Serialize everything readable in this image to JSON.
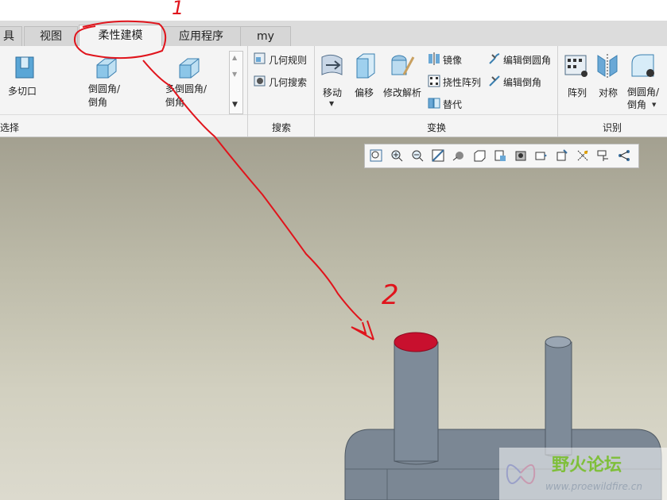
{
  "tabs": {
    "partial": "具",
    "view": "视图",
    "flexible_modeling": "柔性建模",
    "applications": "应用程序",
    "my": "my"
  },
  "ribbon": {
    "select_group": {
      "label": "选择",
      "multi_cut": "多切口",
      "round_chamfer": "倒圆角/\n倒角",
      "multi_round_chamfer": "多倒圆角/\n倒角"
    },
    "search_group": {
      "label": "搜索",
      "geometry_rules": "几何规则",
      "geometry_search": "几何搜索"
    },
    "transform_group": {
      "label": "变换",
      "move": "移动",
      "offset": "偏移",
      "modify_analytic": "修改解析",
      "mirror": "镜像",
      "flex_pattern": "挠性阵列",
      "substitute": "替代",
      "edit_round": "编辑倒圆角",
      "edit_chamfer": "编辑倒角"
    },
    "recognize_group": {
      "label": "识别",
      "pattern": "阵列",
      "symmetry": "对称",
      "round_chamfer": "倒圆角/\n倒角"
    }
  },
  "annotations": {
    "mark1": "1",
    "mark2": "2"
  },
  "watermark": {
    "title": "野火论坛",
    "url": "www.proewildfire.cn"
  },
  "colors": {
    "annotation_red": "#e0141c",
    "selected_face": "#c8102e",
    "model_gray": "#7d8a97"
  }
}
